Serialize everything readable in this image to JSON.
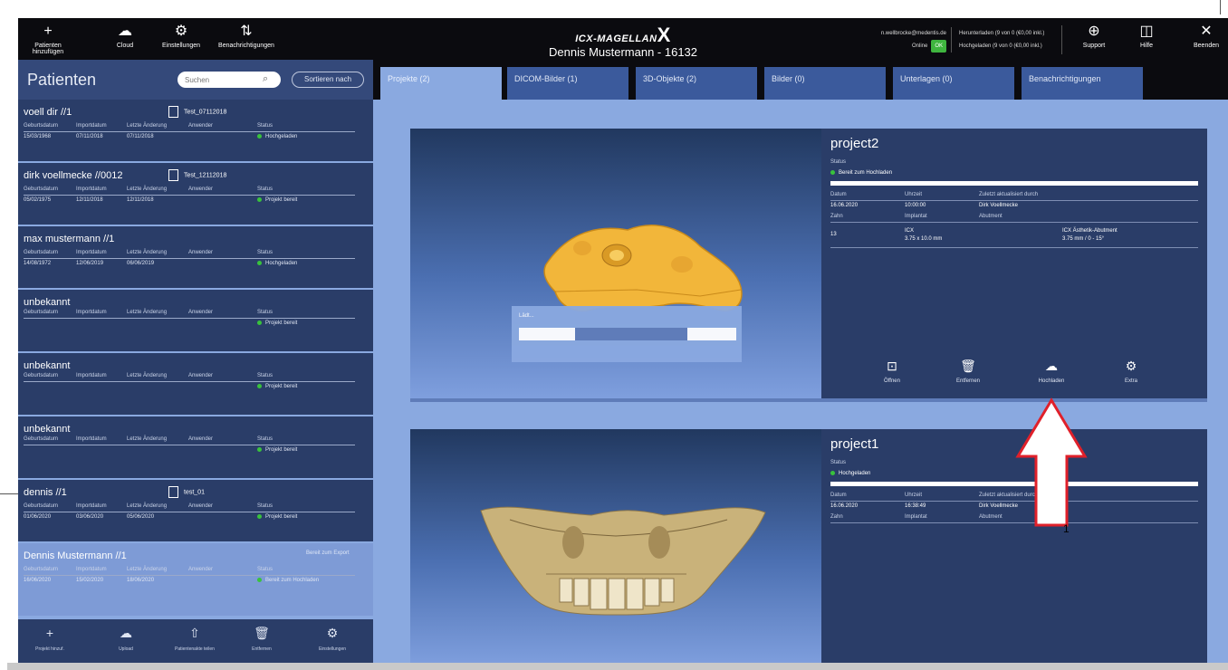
{
  "topbar": {
    "buttons": [
      {
        "icon": "plus-icon",
        "glyph": "+",
        "label": "Patienten hinzufügen"
      },
      {
        "icon": "cloud-icon",
        "glyph": "☁",
        "label": "Cloud"
      },
      {
        "icon": "gear-icon",
        "glyph": "⚙",
        "label": "Einstellungen"
      },
      {
        "icon": "notification-icon",
        "glyph": "⇅",
        "label": "Benachrichtigungen"
      }
    ],
    "brand": {
      "logo": "ICX-MAGELLAN",
      "logo_x": "X",
      "title": "Dennis Mustermann - 16132"
    },
    "account": {
      "email": "n.wellbrocke@medentis.de",
      "online_label": "Online",
      "online_badge": "OK"
    },
    "quota": {
      "download": "Herunterladen (9 von 0 (€0,00 inkl.)",
      "upload": "Hochgeladen (9 von 0 (€0,00 inkl.)"
    },
    "right_buttons": [
      {
        "icon": "support-icon",
        "glyph": "⊕",
        "label": "Support"
      },
      {
        "icon": "help-book-icon",
        "glyph": "◫",
        "label": "Hilfe"
      },
      {
        "icon": "close-icon",
        "glyph": "✕",
        "label": "Beenden"
      }
    ]
  },
  "sidebar": {
    "title": "Patienten",
    "search_placeholder": "Suchen",
    "sort_label": "Sortieren nach",
    "columns": [
      "Geburtsdatum",
      "Importdatum",
      "Letzte Änderung",
      "Anwender"
    ],
    "status_label": "Status",
    "patients": [
      {
        "name": "voell dir //1",
        "file": "Test_07112018",
        "values": [
          "15/03/1968",
          "07/11/2018",
          "07/11/2018",
          ""
        ],
        "status": "Hochgeladen",
        "status_color": "#39c23c"
      },
      {
        "name": "dirk voellmecke //0012",
        "file": "Test_12112018",
        "values": [
          "05/02/1975",
          "12/11/2018",
          "12/11/2018",
          ""
        ],
        "status": "Projekt bereit",
        "status_color": "#39c23c"
      },
      {
        "name": "max mustermann //1",
        "file": "",
        "values": [
          "14/08/1972",
          "12/06/2019",
          "06/06/2019",
          ""
        ],
        "status": "Hochgeladen",
        "status_color": "#39c23c"
      },
      {
        "name": "unbekannt",
        "file": "",
        "values": [
          "",
          "",
          "",
          ""
        ],
        "status": "Projekt bereit",
        "status_color": "#39c23c"
      },
      {
        "name": "unbekannt",
        "file": "",
        "values": [
          "",
          "",
          "",
          ""
        ],
        "status": "Projekt bereit",
        "status_color": "#39c23c"
      },
      {
        "name": "unbekannt",
        "file": "",
        "values": [
          "",
          "",
          "",
          ""
        ],
        "status": "Projekt bereit",
        "status_color": "#39c23c"
      },
      {
        "name": "dennis //1",
        "file": "test_01",
        "values": [
          "01/06/2020",
          "03/06/2020",
          "05/06/2020",
          ""
        ],
        "status": "Projekt bereit",
        "status_color": "#39c23c"
      },
      {
        "name": "Dennis Mustermann //1",
        "file": "",
        "badge": "Bereit zum Export",
        "values": [
          "16/06/2020",
          "15/02/2020",
          "18/06/2020",
          ""
        ],
        "status": "Bereit zum Hochladen",
        "status_color": "#39c23c"
      }
    ],
    "footer": [
      {
        "icon": "add-project-icon",
        "glyph": "+",
        "label": "Projekt hinzuf."
      },
      {
        "icon": "cloud-upload-icon",
        "glyph": "☁",
        "label": "Upload"
      },
      {
        "icon": "export-icon",
        "glyph": "⇧",
        "label": "Patientenakte teilen"
      },
      {
        "icon": "trash-icon",
        "glyph": "🗑",
        "label": "Entfernen"
      },
      {
        "icon": "settings-icon",
        "glyph": "⚙",
        "label": "Einstellungen"
      }
    ]
  },
  "tabs": [
    {
      "label": "Projekte (2)",
      "active": true
    },
    {
      "label": "DICOM-Bilder (1)",
      "active": false
    },
    {
      "label": "3D-Objekte (2)",
      "active": false
    },
    {
      "label": "Bilder (0)",
      "active": false
    },
    {
      "label": "Unterlagen (0)",
      "active": false
    },
    {
      "label": "Benachrichtigungen",
      "active": false
    }
  ],
  "projects": [
    {
      "title": "project2",
      "status_label": "Status",
      "status": "Bereit zum Hochladen",
      "columns": [
        "Datum",
        "Uhrzeit",
        "Zuletzt aktualisiert durch"
      ],
      "values": [
        "16.06.2020",
        "10:00:00",
        "Dirk Voellmecke"
      ],
      "columns2": [
        "Zahn",
        "Implantat",
        "Abutment"
      ],
      "tooth": "13",
      "implant": "ICX",
      "implant_size": "3.75 x 10.0 mm",
      "abutment": "ICX Ästhetik-Abutment",
      "abutment_size": "3.75 mm / 0 - 15°",
      "loading_label": "Lädt...",
      "actions": [
        {
          "icon": "open-icon",
          "glyph": "⊡",
          "label": "Öffnen"
        },
        {
          "icon": "trash-icon",
          "glyph": "🗑",
          "label": "Entfernen"
        },
        {
          "icon": "cloud-upload-icon",
          "glyph": "☁",
          "label": "Hochladen"
        },
        {
          "icon": "gear-icon",
          "glyph": "⚙",
          "label": "Extra"
        }
      ]
    },
    {
      "title": "project1",
      "status_label": "Status",
      "status": "Hochgeladen",
      "columns": [
        "Datum",
        "Uhrzeit",
        "Zuletzt aktualisiert durch"
      ],
      "values": [
        "16.06.2020",
        "16:38:49",
        "Dirk Voellmecke"
      ],
      "columns2": [
        "Zahn",
        "Implantat",
        "Abutment"
      ]
    }
  ],
  "callout": {
    "label": "1"
  }
}
